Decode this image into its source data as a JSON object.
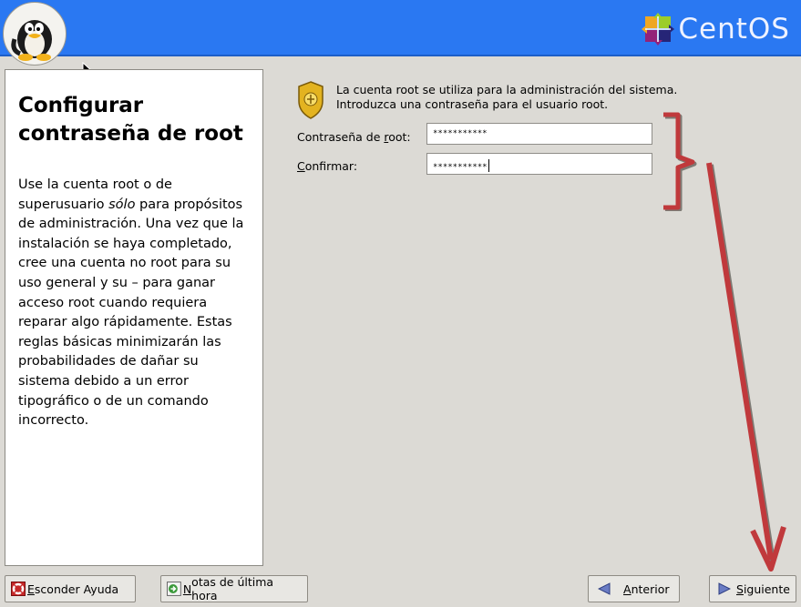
{
  "header": {
    "logo_text": "CentOS",
    "bar_color": "#2a78f2"
  },
  "help": {
    "title_line1": "Configurar",
    "title_line2": "contraseña de root",
    "body_before_em": "Use la cuenta root o de superusuario ",
    "body_em": "sólo",
    "body_after_em": " para propósitos de administración. Una vez que la instalación se haya completado, cree una cuenta no root para su uso general y su  – para ganar acceso root cuando requiera reparar algo rápidamente. Estas reglas básicas minimizarán las probabilidades de dañar su sistema debido a un error tipográfico o de un comando incorrecto."
  },
  "form": {
    "info_line1": "La cuenta root se utiliza para la administración del sistema.",
    "info_line2": "Introduzca una contraseña para el usuario root.",
    "password_label_pre": "Contraseña de ",
    "password_label_accel": "r",
    "password_label_post": "oot:",
    "password_value": "***********",
    "confirm_label_accel": "C",
    "confirm_label_post": "onfirmar:",
    "confirm_value": "***********"
  },
  "buttons": {
    "hide_help_accel": "E",
    "hide_help_rest": "sconder Ayuda",
    "release_notes_accel": "N",
    "release_notes_rest": "otas de última hora",
    "back_accel": "A",
    "back_rest": "nterior",
    "next_accel": "S",
    "next_rest": "iguiente"
  },
  "annotation_color": "#c0393c"
}
